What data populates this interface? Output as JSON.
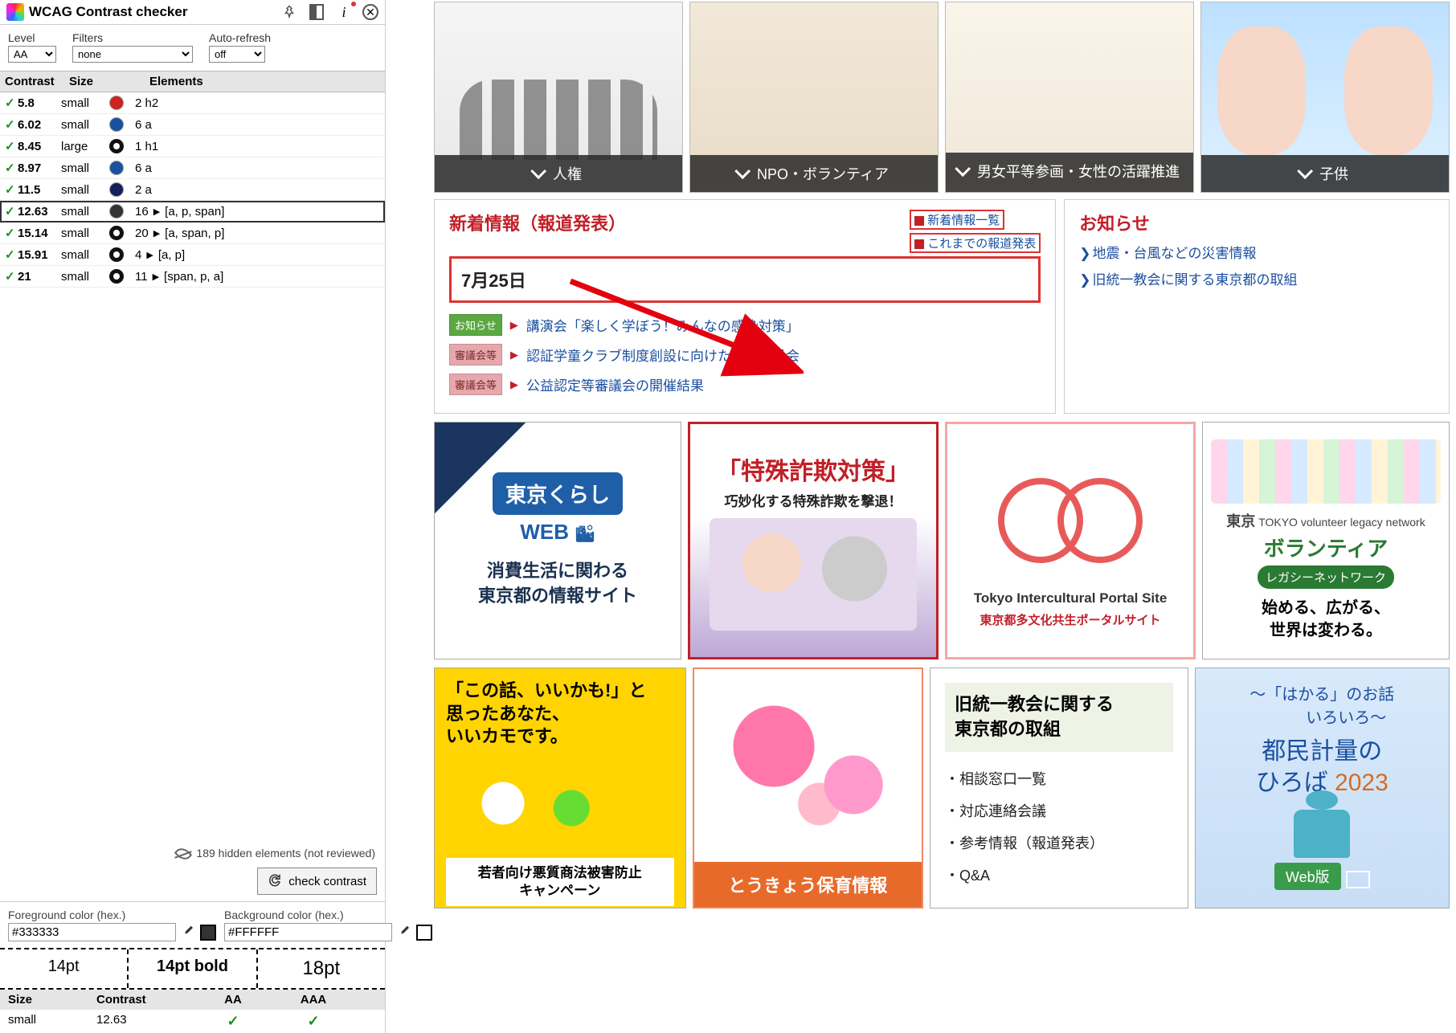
{
  "panel": {
    "title": "WCAG Contrast checker",
    "icons": {
      "pin": "pin-icon",
      "dock": "dock-icon",
      "info": "info-icon",
      "close": "close-icon"
    },
    "controls": {
      "level": {
        "label": "Level",
        "value": "AA"
      },
      "filters": {
        "label": "Filters",
        "value": "none"
      },
      "autorefresh": {
        "label": "Auto-refresh",
        "value": "off"
      }
    },
    "columns": {
      "contrast": "Contrast",
      "size": "Size",
      "elements": "Elements"
    },
    "rows": [
      {
        "ratio": "5.8",
        "size": "small",
        "swatch": "red",
        "count": "2",
        "el": "h2"
      },
      {
        "ratio": "6.02",
        "size": "small",
        "swatch": "blue",
        "count": "6",
        "el": "a"
      },
      {
        "ratio": "8.45",
        "size": "large",
        "swatch": "inv",
        "count": "1",
        "el": "h1"
      },
      {
        "ratio": "8.97",
        "size": "small",
        "swatch": "blue",
        "count": "6",
        "el": "a"
      },
      {
        "ratio": "11.5",
        "size": "small",
        "swatch": "dkbl",
        "count": "2",
        "el": "a"
      },
      {
        "ratio": "12.63",
        "size": "small",
        "swatch": "dark",
        "count": "16",
        "el": "[a, p, span]",
        "selected": true,
        "expand": true
      },
      {
        "ratio": "15.14",
        "size": "small",
        "swatch": "inv",
        "count": "20",
        "el": "[a, span, p]",
        "expand": true
      },
      {
        "ratio": "15.91",
        "size": "small",
        "swatch": "inv",
        "count": "4",
        "el": "[a, p]",
        "expand": true
      },
      {
        "ratio": "21",
        "size": "small",
        "swatch": "inv",
        "count": "11",
        "el": "[span, p, a]",
        "expand": true
      }
    ],
    "hidden_note": "189 hidden elements (not reviewed)",
    "check_btn": "check contrast",
    "fg": {
      "label": "Foreground color (hex.)",
      "value": "#333333"
    },
    "bg": {
      "label": "Background color (hex.)",
      "value": "#FFFFFF"
    },
    "pts": {
      "a": "14pt",
      "b": "14pt bold",
      "c": "18pt"
    },
    "results": {
      "head": {
        "size": "Size",
        "contrast": "Contrast",
        "aa": "AA",
        "aaa": "AAA"
      },
      "rows": [
        {
          "size": "small",
          "contrast": "12.63",
          "aa": "pass",
          "aaa": "pass"
        }
      ]
    }
  },
  "site": {
    "cats": [
      {
        "label": "人権"
      },
      {
        "label": "NPO・ボランティア"
      },
      {
        "label": "男女平等参画・女性の活躍推進"
      },
      {
        "label": "子供"
      }
    ],
    "news": {
      "heading": "新着情報（報道発表）",
      "link1": "新着情報一覧",
      "link2": "これまでの報道発表",
      "date": "7月25日",
      "items": [
        {
          "tag": "お知らせ",
          "tagClass": "green",
          "text": "講演会「楽しく学ぼう！みんなの感染対策」"
        },
        {
          "tag": "審議会等",
          "tagClass": "pink",
          "text": "認証学童クラブ制度創設に向けた専門委員会"
        },
        {
          "tag": "審議会等",
          "tagClass": "pink",
          "text": "公益認定等審議会の開催結果"
        }
      ]
    },
    "notice": {
      "heading": "お知らせ",
      "items": [
        "地震・台風などの災害情報",
        "旧統一教会に関する東京都の取組"
      ]
    },
    "banners": {
      "b1": {
        "pill": "東京くらし",
        "web": "WEB",
        "sub1": "消費生活に関わる",
        "sub2": "東京都の情報サイト"
      },
      "b2": {
        "big": "「特殊詐欺対策」",
        "sm": "巧妙化する特殊詐欺を撃退！"
      },
      "b3": {
        "t1": "Tokyo Intercultural Portal Site",
        "t2": "東京都多文化共生ポータルサイト"
      },
      "b4": {
        "brand1": "東京",
        "brand2": "TOKYO volunteer legacy network",
        "big": "ボランティア",
        "pill": "レガシーネットワーク",
        "tag": "始める、広がる、\n世界は変わる。"
      }
    },
    "banners2": {
      "bb1": {
        "q1": "「この話、いいかも!」と",
        "q2": "思ったあなた、",
        "q3": "いいカモです。",
        "cap1": "若者向け悪質商法被害防止",
        "cap2": "キャンペーン"
      },
      "bb2": {
        "cap": "とうきょう保育情報"
      },
      "bb3": {
        "h1": "旧統一教会に関する",
        "h2": "東京都の取組",
        "items": [
          "・相談窓口一覧",
          "・対応連絡会議",
          "・参考情報（報道発表）",
          "・Q&A"
        ]
      },
      "bb4": {
        "a": "〜「はかる」のお話\n　　　いろいろ〜",
        "b1": "都民計量の",
        "b2": "ひろば",
        "yr": "2023",
        "web": "Web版"
      }
    }
  }
}
